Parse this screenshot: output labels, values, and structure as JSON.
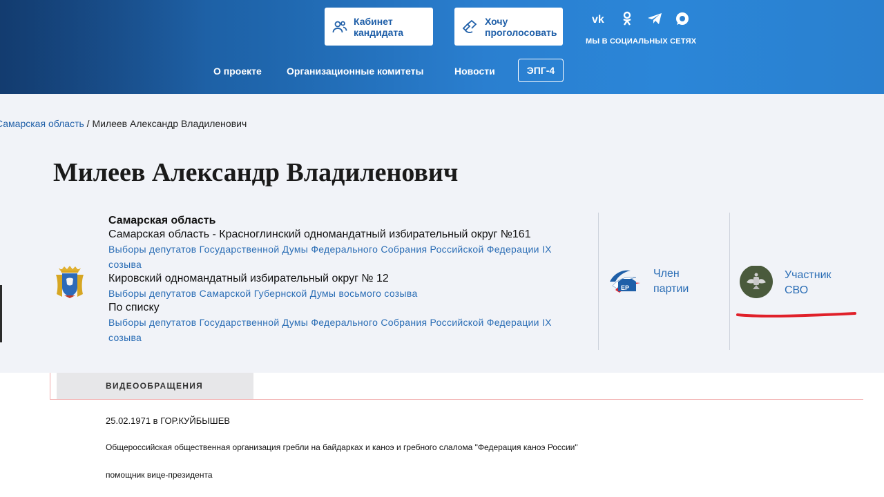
{
  "header": {
    "cabinet_label": "Кабинет\nкандидата",
    "vote_label": "Хочу\nпроголосовать",
    "social_caption": "МЫ В СОЦИАЛЬНЫХ СЕТЯХ",
    "nav": [
      "О проекте",
      "Организационные комитеты",
      "Новости"
    ],
    "epg_label": "ЭПГ-4"
  },
  "breadcrumb": {
    "region": "Самарская область",
    "sep": " / ",
    "current": "Милеев Александр Владиленович"
  },
  "page_title": "Милеев Александр Владиленович",
  "candidate": {
    "region": "Самарская область",
    "entries": [
      {
        "district": "Самарская область - Красноглинский одномандатный избирательный округ №161",
        "election": "Выборы депутатов Государственной Думы Федерального Собрания Российской Федерации IX созыва"
      },
      {
        "district": "Кировский одномандатный избирательный округ № 12",
        "election": "Выборы депутатов Самарской Губернской Думы восьмого созыва"
      },
      {
        "district": "По списку",
        "election": "Выборы депутатов Государственной Думы Федерального Собрания Российской Федерации IX созыва"
      }
    ]
  },
  "badges": {
    "party": "Член\nпартии",
    "svo": "Участник\nСВО"
  },
  "tabs": {
    "video": "ВИДЕООБРАЩЕНИЯ"
  },
  "bio": {
    "birth": "25.02.1971 в ГОР.КУЙБЫШЕВ",
    "org": "Общероссийская общественная организация гребли на байдарках и каноэ и гребного слалома \"Федерация каноэ России\"",
    "position": "помощник вице-президента"
  },
  "colors": {
    "accent": "#1f5fa8",
    "link": "#2a6db5",
    "annotation": "#e0202a"
  }
}
